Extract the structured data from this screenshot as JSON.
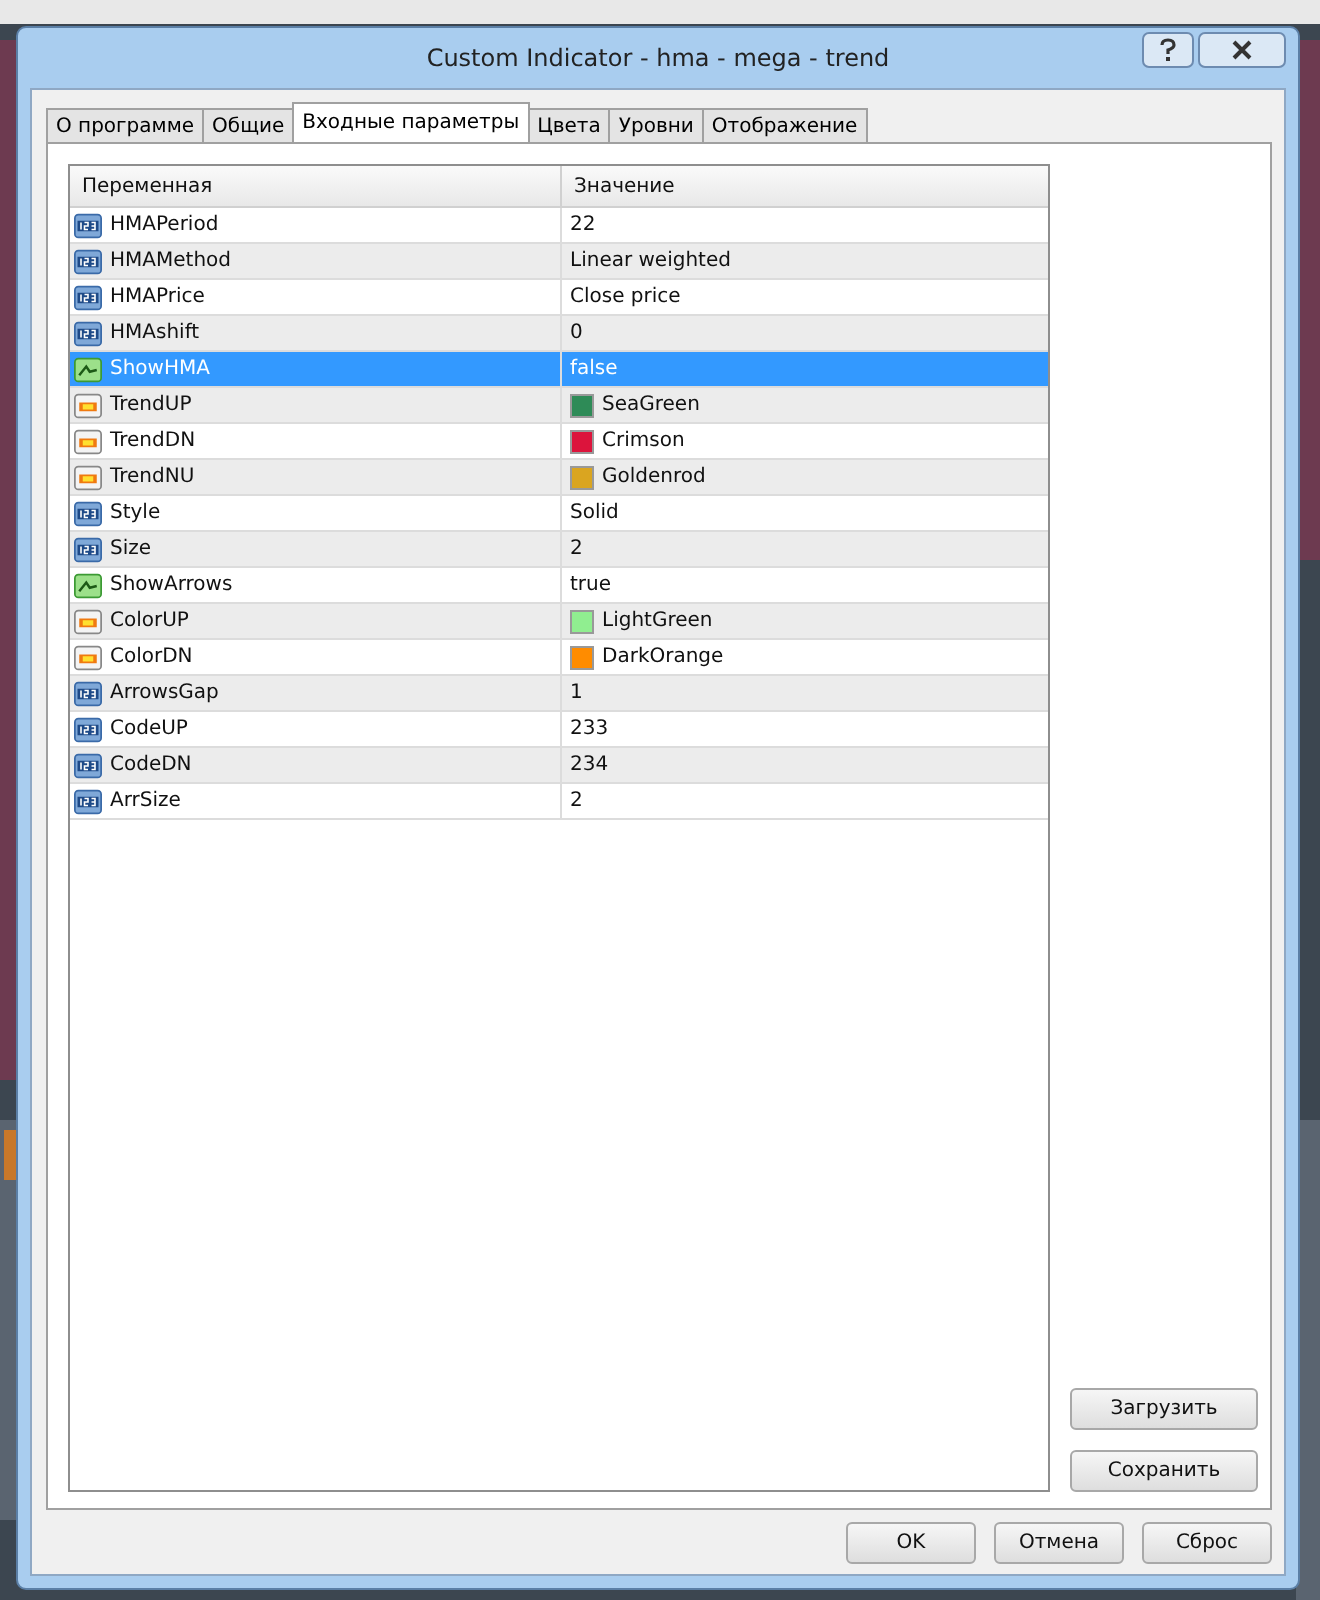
{
  "window": {
    "title": "Custom Indicator - hma - mega - trend"
  },
  "tabs": [
    {
      "label": "О программе",
      "selected": false
    },
    {
      "label": "Общие",
      "selected": false
    },
    {
      "label": "Входные параметры",
      "selected": true
    },
    {
      "label": "Цвета",
      "selected": false
    },
    {
      "label": "Уровни",
      "selected": false
    },
    {
      "label": "Отображение",
      "selected": false
    }
  ],
  "table": {
    "columns": [
      "Переменная",
      "Значение"
    ],
    "rows": [
      {
        "kind": "number",
        "name": "HMAPeriod",
        "value": "22",
        "selected": false
      },
      {
        "kind": "number",
        "name": "HMAMethod",
        "value": "Linear weighted",
        "selected": false
      },
      {
        "kind": "number",
        "name": "HMAPrice",
        "value": "Close price",
        "selected": false
      },
      {
        "kind": "number",
        "name": "HMAshift",
        "value": "0",
        "selected": false
      },
      {
        "kind": "bool",
        "name": "ShowHMA",
        "value": "false",
        "selected": true
      },
      {
        "kind": "color",
        "name": "TrendUP",
        "value": "SeaGreen",
        "color": "#2e8b57",
        "selected": false
      },
      {
        "kind": "color",
        "name": "TrendDN",
        "value": "Crimson",
        "color": "#dc143c",
        "selected": false
      },
      {
        "kind": "color",
        "name": "TrendNU",
        "value": "Goldenrod",
        "color": "#daa520",
        "selected": false
      },
      {
        "kind": "number",
        "name": "Style",
        "value": "Solid",
        "selected": false
      },
      {
        "kind": "number",
        "name": "Size",
        "value": "2",
        "selected": false
      },
      {
        "kind": "bool",
        "name": "ShowArrows",
        "value": "true",
        "selected": false
      },
      {
        "kind": "color",
        "name": "ColorUP",
        "value": "LightGreen",
        "color": "#90ee90",
        "selected": false
      },
      {
        "kind": "color",
        "name": "ColorDN",
        "value": "DarkOrange",
        "color": "#ff8c00",
        "selected": false
      },
      {
        "kind": "number",
        "name": "ArrowsGap",
        "value": "1",
        "selected": false
      },
      {
        "kind": "number",
        "name": "CodeUP",
        "value": "233",
        "selected": false
      },
      {
        "kind": "number",
        "name": "CodeDN",
        "value": "234",
        "selected": false
      },
      {
        "kind": "number",
        "name": "ArrSize",
        "value": "2",
        "selected": false
      }
    ]
  },
  "side_buttons": [
    "Загрузить",
    "Сохранить"
  ],
  "buttons": [
    "OK",
    "Отмена",
    "Сброс"
  ]
}
